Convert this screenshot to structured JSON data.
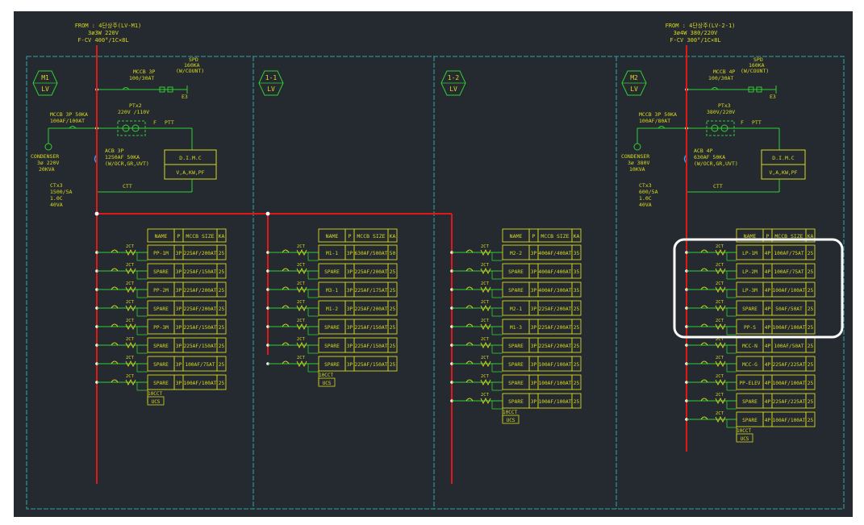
{
  "colors": {
    "background": "#252a30",
    "panel_border": "#2fa0a0",
    "bus_red": "#e01818",
    "text_yellow": "#d8d820",
    "text_green": "#30d030",
    "highlight": "#ffffff"
  },
  "feeder_left": {
    "from": "FROM : 4단상주(LV-M1)",
    "spec": "3ø3W 220V",
    "cable": "F-CV 400°/1C×8L"
  },
  "feeder_right": {
    "from": "FROM : 4단상주(LV-2-1)",
    "spec": "3ø4W 380/220V",
    "cable": "F-CV 300°/1C×8L"
  },
  "panels": [
    {
      "tag_top": "M1",
      "tag_bottom": "LV"
    },
    {
      "tag_top": "1-1",
      "tag_bottom": "LV"
    },
    {
      "tag_top": "1-2",
      "tag_bottom": "LV"
    },
    {
      "tag_top": "M2",
      "tag_bottom": "LV"
    }
  ],
  "left_equipment": {
    "spd": [
      "SPD",
      "160KA",
      "(W/COUNT)"
    ],
    "mccb_spd": [
      "MCCB 3P",
      "100/30AT"
    ],
    "e": "E3",
    "pt": [
      "PTx2",
      "220V /110V"
    ],
    "pt_fuse": "F",
    "ptt": "PTT",
    "mccb_cond": [
      "MCCB 3P 50KA",
      "100AF/100AT"
    ],
    "condenser": [
      "CONDENSER",
      "3ø 220V",
      "20KVA"
    ],
    "acb": [
      "ACB 3P",
      "1250AF 50KA",
      "(W/OCR,GR,UVT)"
    ],
    "dimc": [
      "D.I.M.C",
      "V,A,KW,PF"
    ],
    "ct": [
      "CTx3",
      "1500/5A",
      "1.0C",
      "40VA"
    ],
    "ctt": "CTT"
  },
  "right_equipment": {
    "spd": [
      "SPD",
      "160KA",
      "(W/COUNT)"
    ],
    "mccb_spd": [
      "MCCB 4P",
      "100/30AT"
    ],
    "e": "E3",
    "pt": [
      "PTx3",
      "380V/220V"
    ],
    "pt_fuse": "F",
    "ptt": "PTT",
    "mccb_cond": [
      "MCCB 3P 50KA",
      "100AF/80AT"
    ],
    "condenser": [
      "CONDENSER",
      "3ø 380V",
      "10KVA"
    ],
    "acb": [
      "ACB 4P",
      "630AF 50KA",
      "(W/OCR,GR,UVT)"
    ],
    "dimc": [
      "D.I.M.C",
      "V,A,KW,PF"
    ],
    "ct": [
      "CTx3",
      "600/5A",
      "1.0C",
      "40VA"
    ],
    "ctt": "CTT"
  },
  "table_header": {
    "name": "NAME",
    "p": "P",
    "size": "MCCB SIZE",
    "ka": "KA"
  },
  "ct_label": "2CT",
  "zct_label": "ZCT",
  "tables": [
    {
      "rows": [
        {
          "name": "PP-1M",
          "p": "3P",
          "size": "225AF/200AT",
          "ka": "25"
        },
        {
          "name": "SPARE",
          "p": "3P",
          "size": "225AF/150AT",
          "ka": "25"
        },
        {
          "name": "PP-2M",
          "p": "3P",
          "size": "225AF/200AT",
          "ka": "25"
        },
        {
          "name": "SPARE",
          "p": "3P",
          "size": "225AF/200AT",
          "ka": "25"
        },
        {
          "name": "PP-3M",
          "p": "3P",
          "size": "225AF/150AT",
          "ka": "25"
        },
        {
          "name": "SPARE",
          "p": "3P",
          "size": "225AF/150AT",
          "ka": "25"
        },
        {
          "name": "SPARE",
          "p": "3P",
          "size": "100AF/75AT",
          "ka": "25"
        },
        {
          "name": "SPARE",
          "p": "3P",
          "size": "100AF/100AT",
          "ka": "25"
        }
      ],
      "footer": "10CCT",
      "footer_box": "UCS"
    },
    {
      "rows": [
        {
          "name": "M1-1",
          "p": "3P",
          "size": "630AF/500AT",
          "ka": "50"
        },
        {
          "name": "SPARE",
          "p": "3P",
          "size": "225AF/200AT",
          "ka": "25"
        },
        {
          "name": "M3-1",
          "p": "3P",
          "size": "225AF/175AT",
          "ka": "25"
        },
        {
          "name": "M1-2",
          "p": "3P",
          "size": "225AF/200AT",
          "ka": "25"
        },
        {
          "name": "SPARE",
          "p": "3P",
          "size": "225AF/150AT",
          "ka": "25"
        },
        {
          "name": "SPARE",
          "p": "3P",
          "size": "225AF/150AT",
          "ka": "25"
        },
        {
          "name": "SPARE",
          "p": "3P",
          "size": "225AF/150AT",
          "ka": "25"
        }
      ],
      "footer": "10CCT",
      "footer_box": "UCS"
    },
    {
      "rows": [
        {
          "name": "M2-2",
          "p": "3P",
          "size": "400AF/400AT",
          "ka": "35"
        },
        {
          "name": "SPARE",
          "p": "3P",
          "size": "400AF/400AT",
          "ka": "35"
        },
        {
          "name": "SPARE",
          "p": "3P",
          "size": "400AF/300AT",
          "ka": "35"
        },
        {
          "name": "M2-1",
          "p": "3P",
          "size": "225AF/200AT",
          "ka": "25"
        },
        {
          "name": "M1-3",
          "p": "3P",
          "size": "225AF/200AT",
          "ka": "25"
        },
        {
          "name": "SPARE",
          "p": "3P",
          "size": "225AF/200AT",
          "ka": "25"
        },
        {
          "name": "SPARE",
          "p": "3P",
          "size": "100AF/100AT",
          "ka": "25"
        },
        {
          "name": "SPARE",
          "p": "3P",
          "size": "100AF/100AT",
          "ka": "25"
        },
        {
          "name": "SPARE",
          "p": "3P",
          "size": "100AF/100AT",
          "ka": "25"
        }
      ],
      "footer": "10CCT",
      "footer_box": "UCS"
    },
    {
      "rows": [
        {
          "name": "LP-1M",
          "p": "4P",
          "size": "100AF/75AT",
          "ka": "25"
        },
        {
          "name": "LP-2M",
          "p": "4P",
          "size": "100AF/75AT",
          "ka": "25"
        },
        {
          "name": "LP-3M",
          "p": "4P",
          "size": "100AF/100AT",
          "ka": "25"
        },
        {
          "name": "SPARE",
          "p": "4P",
          "size": "50AF/50AT",
          "ka": "25"
        },
        {
          "name": "PP-S",
          "p": "4P",
          "size": "100AF/100AT",
          "ka": "25"
        },
        {
          "name": "MCC-N",
          "p": "4P",
          "size": "100AF/50AT",
          "ka": "25"
        },
        {
          "name": "MCC-G",
          "p": "4P",
          "size": "225AF/225AT",
          "ka": "25"
        },
        {
          "name": "PP-ELEV",
          "p": "4P",
          "size": "100AF/100AT",
          "ka": "25"
        },
        {
          "name": "SPARE",
          "p": "4P",
          "size": "225AF/225AT",
          "ka": "25"
        },
        {
          "name": "SPARE",
          "p": "4P",
          "size": "100AF/100AT",
          "ka": "25"
        }
      ],
      "footer": "10CCT",
      "footer_box": "UCS"
    }
  ]
}
